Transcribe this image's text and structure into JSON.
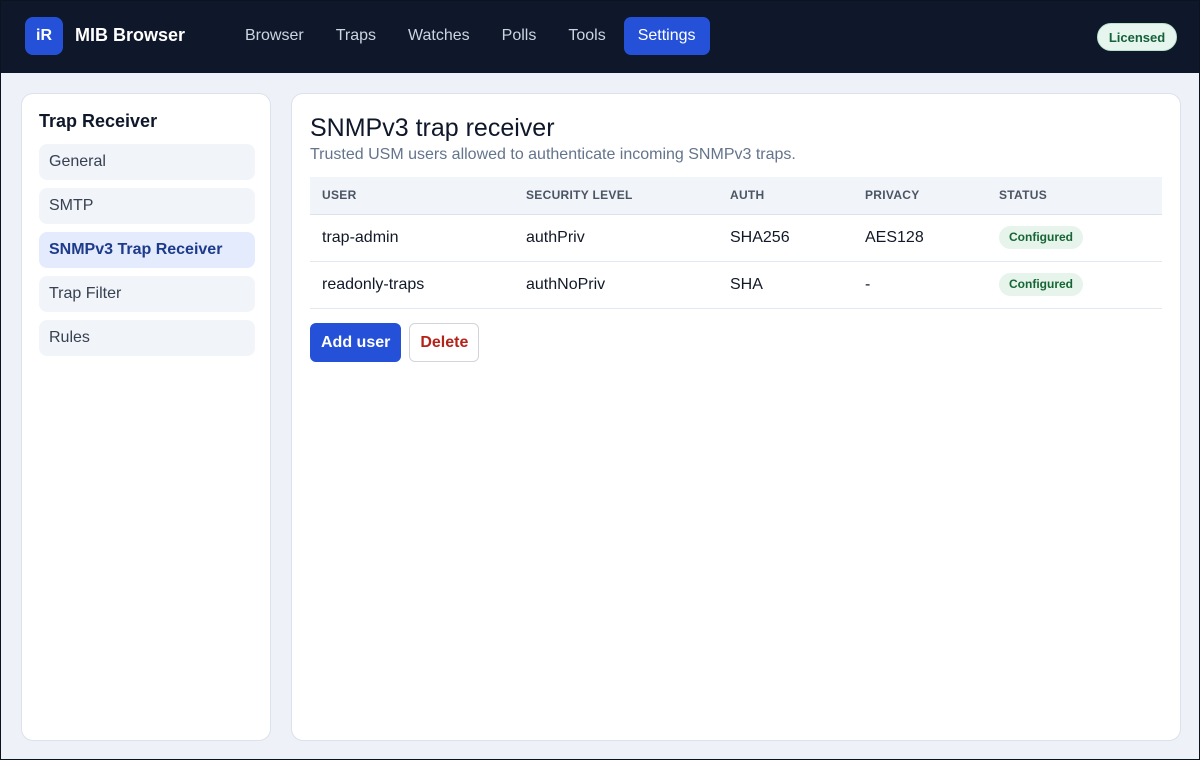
{
  "app": {
    "logo_text": "iR",
    "title": "MIB Browser",
    "license_badge": "Licensed"
  },
  "nav": {
    "items": [
      {
        "label": "Browser",
        "active": false
      },
      {
        "label": "Traps",
        "active": false
      },
      {
        "label": "Watches",
        "active": false
      },
      {
        "label": "Polls",
        "active": false
      },
      {
        "label": "Tools",
        "active": false
      },
      {
        "label": "Settings",
        "active": true
      }
    ]
  },
  "sidebar": {
    "title": "Trap Receiver",
    "items": [
      {
        "label": "General",
        "active": false
      },
      {
        "label": "SMTP",
        "active": false
      },
      {
        "label": "SNMPv3 Trap Receiver",
        "active": true
      },
      {
        "label": "Trap Filter",
        "active": false
      },
      {
        "label": "Rules",
        "active": false
      }
    ]
  },
  "main": {
    "title": "SNMPv3 trap receiver",
    "subtitle": "Trusted USM users allowed to authenticate incoming SNMPv3 traps.",
    "table": {
      "headers": [
        "USER",
        "SECURITY LEVEL",
        "AUTH",
        "PRIVACY",
        "STATUS"
      ],
      "rows": [
        [
          "trap-admin",
          "authPriv",
          "SHA256",
          "AES128",
          "Configured"
        ],
        [
          "readonly-traps",
          "authNoPriv",
          "SHA",
          "-",
          "Configured"
        ]
      ]
    },
    "actions": {
      "add_label": "Add user",
      "delete_label": "Delete"
    }
  },
  "colors": {
    "accent": "#2451d8",
    "topbar": "#0f172a",
    "success": "#166534",
    "danger": "#b42318"
  }
}
